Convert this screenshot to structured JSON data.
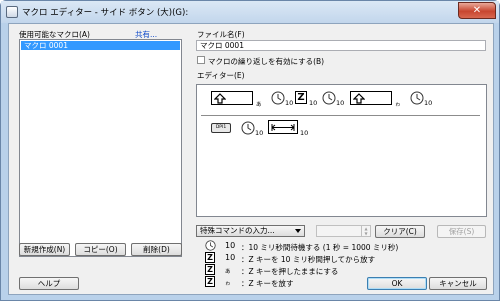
{
  "window": {
    "title": "マクロ エディター - サイド ボタン (大)(G):",
    "close": "✕"
  },
  "left": {
    "label": "使用可能なマクロ(A)",
    "share": "共有...",
    "macros": [
      "マクロ 0001"
    ],
    "buttons": {
      "new": "新規作成(N)",
      "copy": "コピー(O)",
      "delete": "削除(D)"
    }
  },
  "right": {
    "filename_label": "ファイル名(F)",
    "filename_value": "マクロ 0001",
    "repeat_label": "マクロの繰り返しを有効にする(B)",
    "editor_label": "エディター(E)",
    "sequence": [
      {
        "type": "key-up-down",
        "key": "⇧",
        "suffix": "あ"
      },
      {
        "type": "wait",
        "value": "10"
      },
      {
        "type": "key",
        "key": "Z",
        "value": "10"
      },
      {
        "type": "wait",
        "value": "10"
      },
      {
        "type": "key-up-down",
        "key": "⇧",
        "suffix": "ゎ"
      },
      {
        "type": "wait",
        "value": "10"
      },
      {
        "type": "dpi",
        "label": "DPI1"
      },
      {
        "type": "wait",
        "value": "10"
      },
      {
        "type": "scroll",
        "value": "10"
      }
    ],
    "special_command": "特殊コマンドの入力...",
    "clear": "クリア(C)",
    "save": "保存(S)"
  },
  "legend": [
    {
      "icon": "clock",
      "value": "10",
      "text": "：10 ミリ秒間待機する (1 秒 = 1000 ミリ秒)"
    },
    {
      "icon": "key-z",
      "value": "10",
      "text": "：Z キーを 10 ミリ秒間押してから放す"
    },
    {
      "icon": "key-z",
      "value": "あ",
      "text": "：Z キーを押したままにする"
    },
    {
      "icon": "key-z",
      "value": "ゎ",
      "text": "：Z キーを放す"
    }
  ],
  "footer": {
    "help": "ヘルプ",
    "ok": "OK",
    "cancel": "キャンセル"
  }
}
